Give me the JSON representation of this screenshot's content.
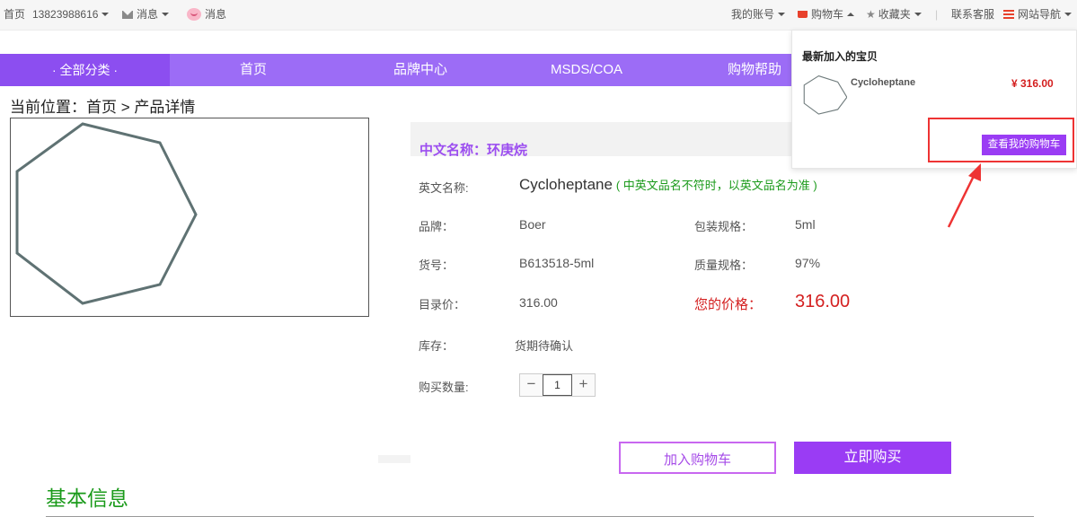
{
  "topbar": {
    "home": "首页",
    "phone": "13823988616",
    "messages_1": "消息",
    "messages_2": "消息",
    "my_account": "我的账号",
    "cart": "购物车",
    "favorites": "收藏夹",
    "separator": "|",
    "contact": "联系客服",
    "site_nav": "网站导航"
  },
  "nav": {
    "all_categories": "· 全部分类 ·",
    "items": [
      "首页",
      "品牌中心",
      "MSDS/COA",
      "购物帮助"
    ]
  },
  "breadcrumb": "当前位置：首页 > 产品详情",
  "product": {
    "cn_name": "中文名称：环庚烷",
    "en_label": "英文名称:",
    "en_name": "Cycloheptane",
    "en_note": "( 中英文品名不符时，以英文品名为准 )",
    "brand_label": "品牌：",
    "brand": "Boer",
    "pack_label": "包装规格：",
    "pack": "5ml",
    "sku_label": "货号：",
    "sku": "B613518-5ml",
    "quality_label": "质量规格：",
    "quality": "97%",
    "list_price_label": "目录价：",
    "list_price": "316.00",
    "your_price_label": "您的价格：",
    "your_price": "316.00",
    "stock_label": "库存：",
    "stock": "货期待确认",
    "qty_label": "购买数量:",
    "qty_minus": "−",
    "qty_value": "1",
    "qty_plus": "+",
    "add_to_cart": "加入购物车",
    "buy_now": "立即购买"
  },
  "section_title": "基本信息",
  "cart_popup": {
    "title": "最新加入的宝贝",
    "item_name": "Cycloheptane",
    "item_price": "¥ 316.00",
    "view_cart": "查看我的购物车"
  },
  "colors": {
    "nav": "#9c6cf6",
    "nav_active": "#8c4ef0",
    "accent": "#9a3cf4",
    "price": "#d42020",
    "green": "#1a9a1a",
    "highlight": "#e33333"
  }
}
